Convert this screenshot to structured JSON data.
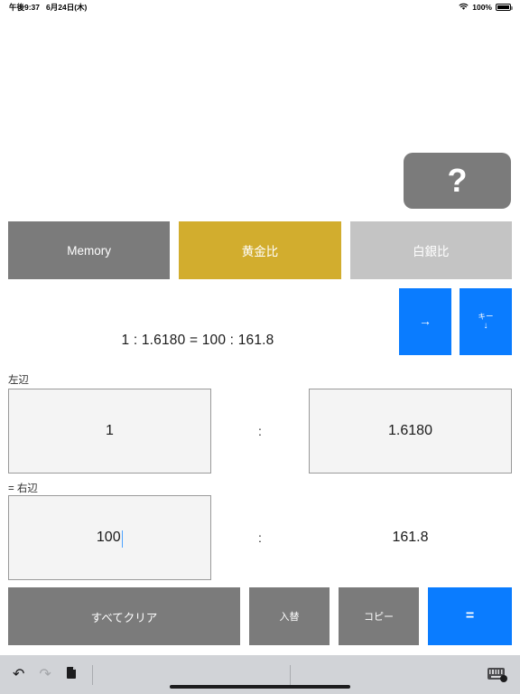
{
  "status_bar": {
    "time": "午後9:37",
    "date": "6月24日(木)",
    "wifi_icon": "wifi-icon",
    "battery_percent": "100%",
    "battery_icon": "battery-icon"
  },
  "help": {
    "label": "?",
    "name": "help-button"
  },
  "modes": [
    {
      "label": "Memory",
      "color": "#7b7b7b",
      "state": "normal"
    },
    {
      "label": "黄金比",
      "color": "#d2ad2e",
      "state": "selected"
    },
    {
      "label": "白銀比",
      "color": "#c4c4c4",
      "state": "normal"
    }
  ],
  "formula": {
    "text": "1 : 1.6180 = 100 : 161.8"
  },
  "side_buttons": {
    "apply": {
      "icon": "arrow-right-icon",
      "glyph": "→",
      "color": "#0a7cff"
    },
    "keyboard": {
      "label": "キー",
      "glyph": "↓",
      "color": "#0a7cff"
    }
  },
  "sections": {
    "left_label": "左辺",
    "right_label": "= 右辺"
  },
  "ratio_rows": [
    {
      "left_value": "1",
      "separator": ":",
      "right_value": "1.6180",
      "left_editable": true,
      "right_editable": true,
      "left_focused": false
    },
    {
      "left_value": "100",
      "separator": ":",
      "right_value": "161.8",
      "left_editable": true,
      "right_editable": false,
      "left_focused": true
    }
  ],
  "actions": [
    {
      "label": "すべてクリア",
      "color": "#7b7b7b"
    },
    {
      "label": "入替",
      "color": "#7b7b7b"
    },
    {
      "label": "コピー",
      "color": "#7b7b7b"
    },
    {
      "label": "=",
      "color": "#0a7cff"
    }
  ],
  "toolbar": {
    "undo_icon": "undo-icon",
    "undo_glyph": "↶",
    "redo_icon": "redo-icon",
    "redo_glyph": "↷",
    "paste_icon": "paste-icon",
    "paste_glyph": "❐",
    "keyboard_dismiss_icon": "keyboard-dismiss-icon"
  }
}
